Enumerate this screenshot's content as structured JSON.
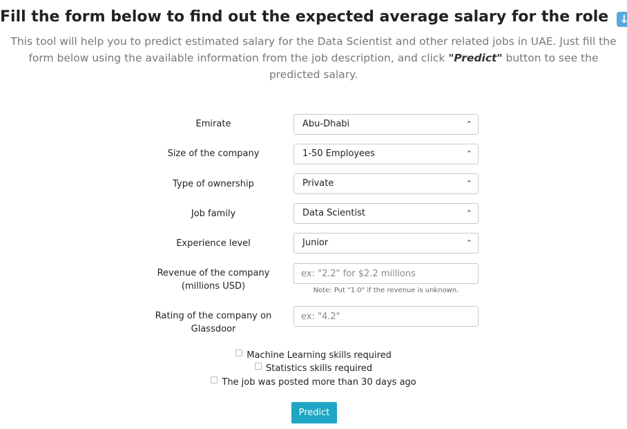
{
  "header": {
    "title": "Fill the form below to find out the expected average salary for the role",
    "title_icon": "down-arrow-emoji",
    "intro_before": "This tool will help you to predict estimated salary for the Data Scientist and other related jobs in UAE. Just fill the form below using the available information from the job description, and click ",
    "intro_emphasis": "\"Predict\"",
    "intro_after": " button to see the predicted salary."
  },
  "form": {
    "emirate": {
      "label": "Emirate",
      "value": "Abu-Dhabi"
    },
    "company_size": {
      "label": "Size of the company",
      "value": "1-50 Employees"
    },
    "ownership": {
      "label": "Type of ownership",
      "value": "Private"
    },
    "job_family": {
      "label": "Job family",
      "value": "Data Scientist"
    },
    "experience": {
      "label": "Experience level",
      "value": "Junior"
    },
    "revenue": {
      "label_line1": "Revenue of the company",
      "label_line2": "(millions USD)",
      "placeholder": "ex: \"2.2\" for $2.2 millions",
      "value": "",
      "note": "Note: Put \"1.0\" if the revenue is unknown."
    },
    "rating": {
      "label_line1": "Rating of the company on",
      "label_line2": "Glassdoor",
      "placeholder": "ex: \"4.2\"",
      "value": ""
    },
    "checkboxes": [
      {
        "label": "Machine Learning skills required",
        "checked": false
      },
      {
        "label": "Statistics skills required",
        "checked": false
      },
      {
        "label": "The job was posted more than 30 days ago",
        "checked": false
      }
    ],
    "submit_label": "Predict"
  },
  "colors": {
    "primary_button": "#1ea7c4",
    "intro_text": "#777777",
    "emoji_bg": "#5aa7e0"
  }
}
